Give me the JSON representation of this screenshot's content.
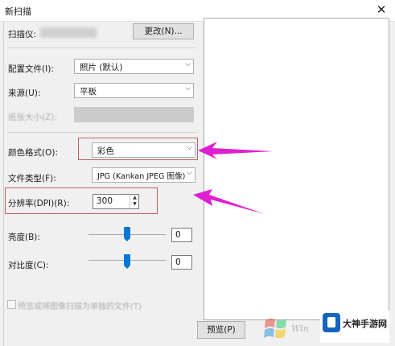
{
  "window": {
    "title": "新扫描",
    "close_glyph": "✕"
  },
  "scanner": {
    "label": "扫描仪:",
    "change_button": "更改(N)..."
  },
  "profile": {
    "label": "配置文件(I):",
    "value": "照片 (默认)"
  },
  "source": {
    "label": "来源(U):",
    "value": "平板"
  },
  "paper_size": {
    "label": "纸张大小(Z):"
  },
  "color_format": {
    "label": "颜色格式(O):",
    "value": "彩色"
  },
  "file_type": {
    "label": "文件类型(F):",
    "value": "JPG (Kankan JPEG 图像)"
  },
  "resolution": {
    "label": "分辨率(DPI)(R):",
    "value": "300"
  },
  "brightness": {
    "label": "亮度(B):",
    "value": "0",
    "level_fraction": 0.5
  },
  "contrast": {
    "label": "对比度(C):",
    "value": "0",
    "level_fraction": 0.5
  },
  "separate_files": {
    "label": "预览或将图像扫描为单独的文件(T)"
  },
  "preview_button": {
    "label": "预览(P)"
  },
  "watermark": {
    "name": "大神手游网"
  },
  "colors": {
    "arrow": "#e020d0",
    "accent": "#0078d7"
  }
}
